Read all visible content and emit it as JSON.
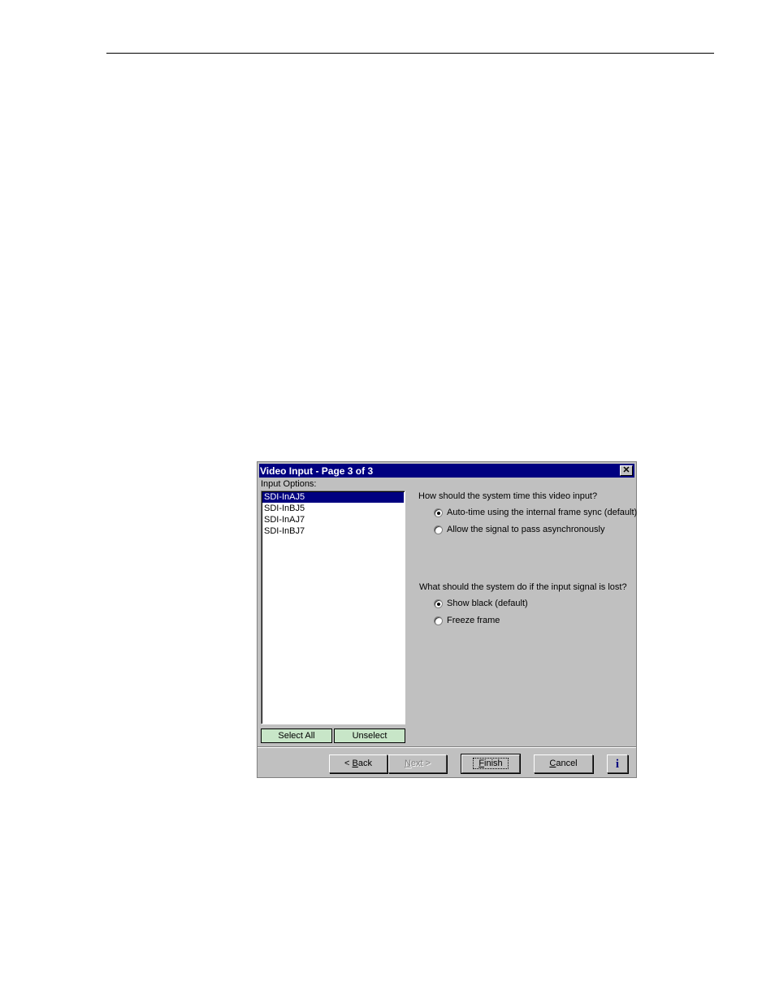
{
  "dialog": {
    "title": "Video Input - Page 3 of 3",
    "close_glyph": "✕",
    "input_options_label": "Input Options:",
    "list_items": [
      "SDI-InAJ5",
      "SDI-InBJ5",
      "SDI-InAJ7",
      "SDI-InBJ7"
    ],
    "selected_item": "SDI-InAJ5",
    "select_all_label": "Select All",
    "unselect_label": "Unselect",
    "timing": {
      "question": "How should the system time this video input?",
      "options": [
        {
          "label": "Auto-time using the internal frame sync (default)",
          "checked": true
        },
        {
          "label": "Allow the signal to pass asynchronously",
          "checked": false
        }
      ]
    },
    "signal_lost": {
      "question": "What should the system do if the input signal is lost?",
      "options": [
        {
          "label": "Show black (default)",
          "checked": true
        },
        {
          "label": "Freeze frame",
          "checked": false
        }
      ]
    },
    "buttons": {
      "back": {
        "prefix": "< ",
        "mnemonic": "B",
        "rest": "ack"
      },
      "next": {
        "mnemonic": "N",
        "rest": "ext",
        "suffix": " >",
        "disabled": true
      },
      "finish": {
        "mnemonic": "F",
        "rest": "inish"
      },
      "cancel": {
        "mnemonic": "C",
        "rest": "ancel"
      },
      "info": "i"
    }
  }
}
